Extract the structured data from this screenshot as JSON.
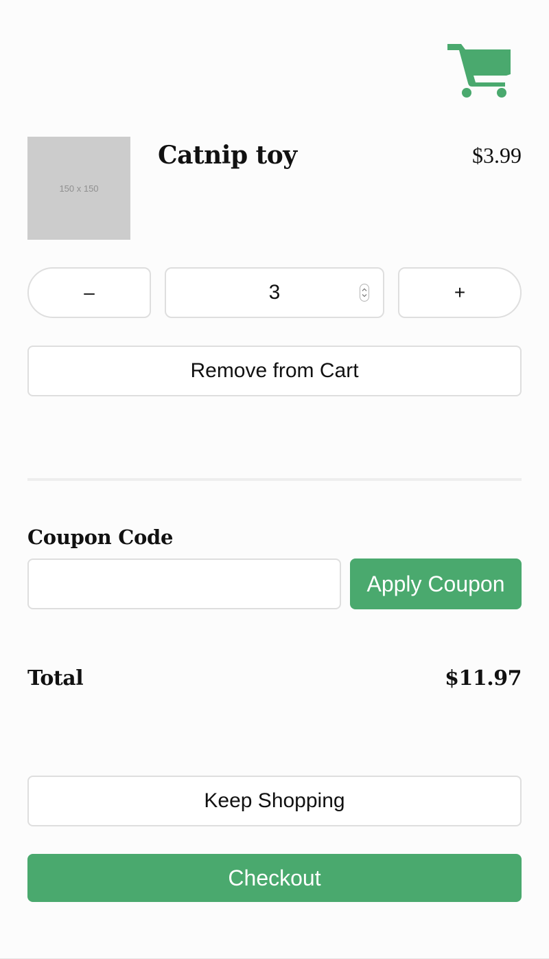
{
  "cart": {
    "icon": "shopping-cart-icon",
    "accent_color": "#4aa96e"
  },
  "product": {
    "image_placeholder": "150 x 150",
    "name": "Catnip toy",
    "price": "$3.99"
  },
  "quantity": {
    "decrement_label": "–",
    "value": "3",
    "increment_label": "+"
  },
  "remove_label": "Remove from Cart",
  "coupon": {
    "label": "Coupon Code",
    "value": "",
    "apply_label": "Apply Coupon"
  },
  "total": {
    "label": "Total",
    "value": "$11.97"
  },
  "keep_shopping_label": "Keep Shopping",
  "checkout_label": "Checkout"
}
